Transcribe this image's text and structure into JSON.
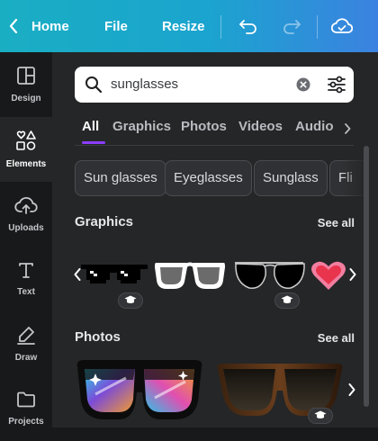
{
  "topbar": {
    "home_label": "Home",
    "file_label": "File",
    "resize_label": "Resize"
  },
  "sidebar": {
    "items": [
      {
        "label": "Design",
        "icon": "layout-icon"
      },
      {
        "label": "Elements",
        "icon": "shapes-icon",
        "active": true
      },
      {
        "label": "Uploads",
        "icon": "cloud-upload-icon"
      },
      {
        "label": "Text",
        "icon": "text-icon"
      },
      {
        "label": "Draw",
        "icon": "pen-icon"
      },
      {
        "label": "Projects",
        "icon": "folder-icon"
      }
    ]
  },
  "search": {
    "value": "sunglasses"
  },
  "tabs": [
    "All",
    "Graphics",
    "Photos",
    "Videos",
    "Audio"
  ],
  "active_tab": "All",
  "chips": [
    "Sun glasses",
    "Eyeglasses",
    "Sunglass",
    "Fli"
  ],
  "graphics": {
    "title": "Graphics",
    "see_all": "See all"
  },
  "photos": {
    "title": "Photos",
    "see_all": "See all"
  },
  "colors": {
    "topbar_start": "#1aaec3",
    "topbar_end": "#3b82e0",
    "accent": "#8b3dff",
    "panel_bg": "#252627",
    "sidebar_bg": "#18191b"
  }
}
